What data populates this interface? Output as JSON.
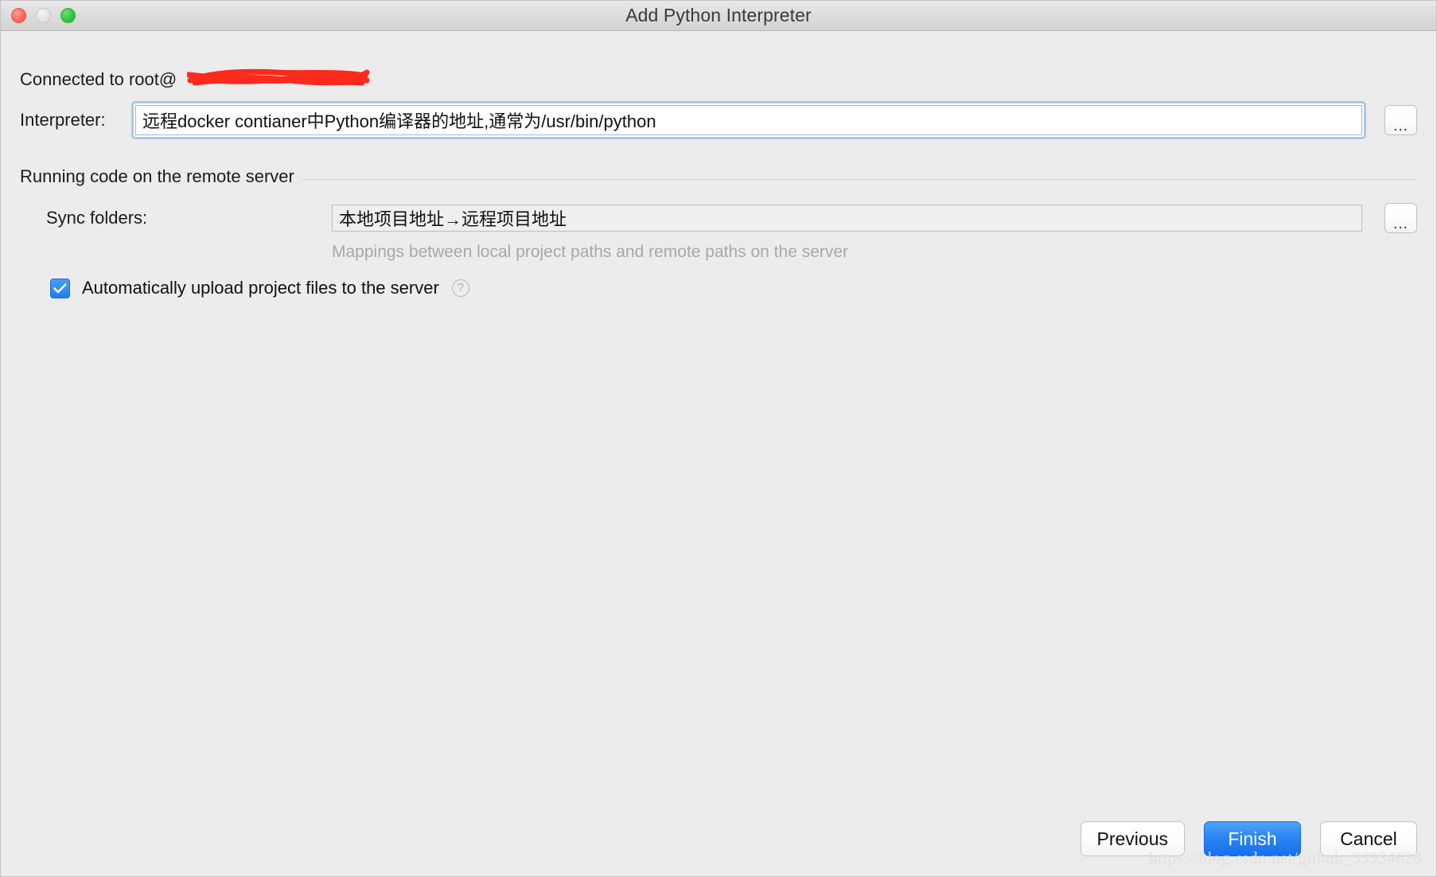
{
  "window": {
    "title": "Add Python Interpreter",
    "traffic_lights": [
      "close-red",
      "minimize-gray",
      "zoom-green"
    ]
  },
  "connection": {
    "status_prefix": "Connected to root@",
    "host_redacted": true
  },
  "interpreter": {
    "label": "Interpreter:",
    "value": "远程docker contianer中Python编译器的地址,通常为/usr/bin/python",
    "browse_label": "...",
    "focused": true
  },
  "remote_group": {
    "title": "Running code on the remote server",
    "sync_folders": {
      "label": "Sync folders:",
      "value": "本地项目地址→远程项目地址",
      "browse_label": "..."
    },
    "hint": "Mappings between local project paths and remote paths on the server",
    "auto_upload": {
      "label": "Automatically upload project files to the server",
      "checked": true,
      "help_glyph": "?"
    }
  },
  "footer": {
    "previous_label": "Previous",
    "finish_label": "Finish",
    "cancel_label": "Cancel"
  },
  "watermark": "https://blog.csdn.net/github_33934628",
  "colors": {
    "accent_blue": "#2a85f3",
    "focus_ring": "#a7c8e8",
    "window_bg": "#ececec",
    "redaction_red": "#fb2a1d"
  }
}
